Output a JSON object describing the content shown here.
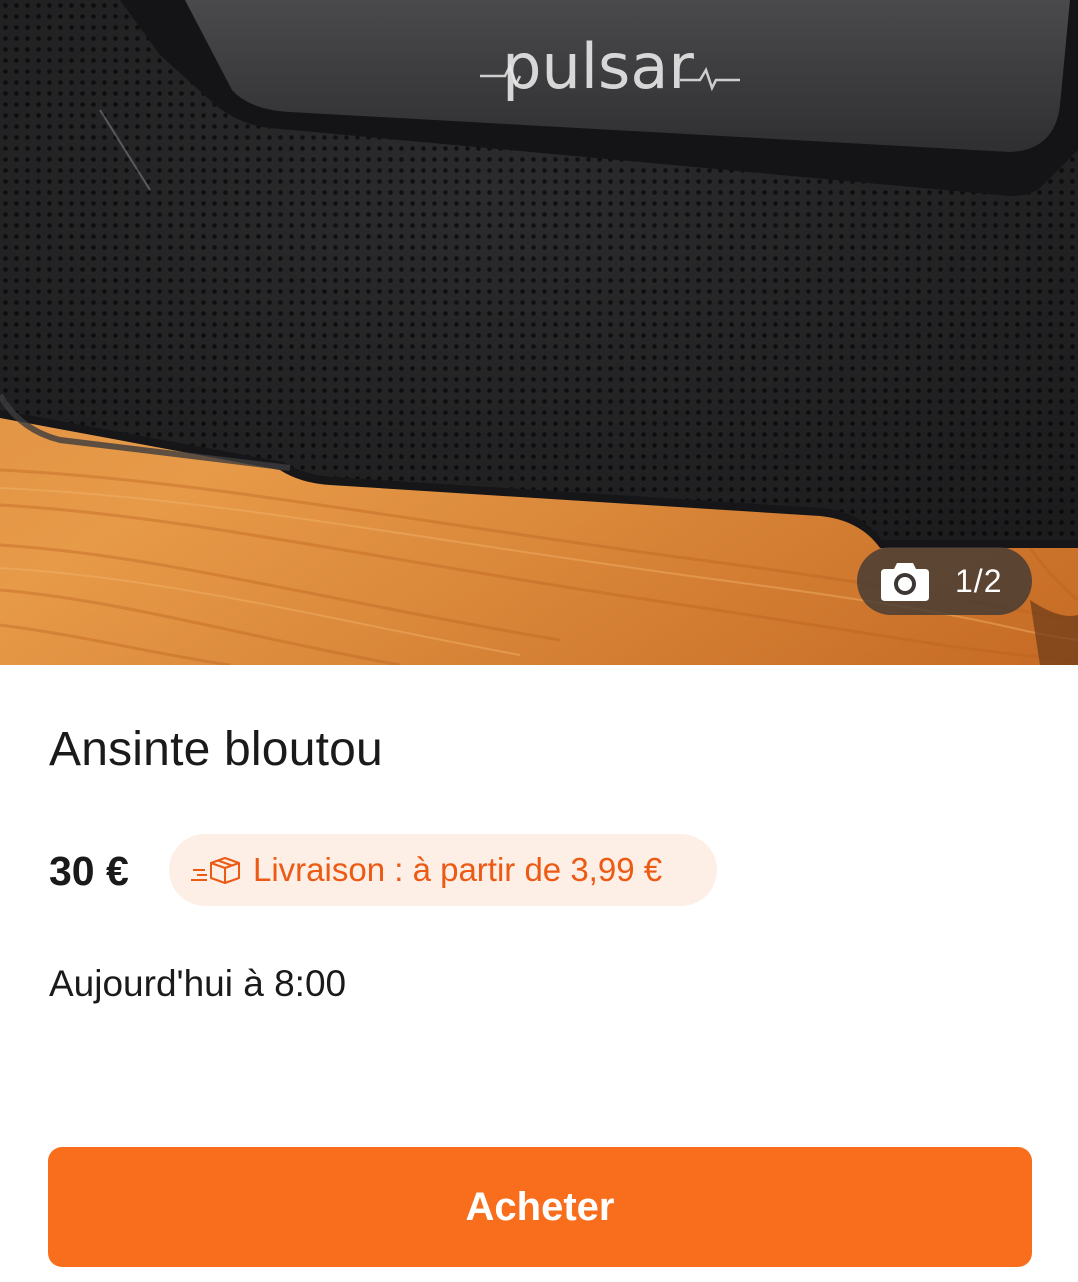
{
  "listing": {
    "photo_alt": "Enceinte Pulsar",
    "photo_brand_text": "pulsar",
    "photo_counter": "1/2",
    "title": "Ansinte bloutou",
    "price": "30 €",
    "delivery": "Livraison : à partir de 3,99 €",
    "date": "Aujourd'hui à 8:00"
  },
  "actions": {
    "buy_label": "Acheter"
  },
  "icons": {
    "photo_counter_icon": "camera-icon",
    "delivery_icon": "delivery-truck-icon"
  },
  "colors": {
    "accent": "#f86e1c",
    "delivery_text": "#ec5a13",
    "delivery_badge_bg": "#fdeee6",
    "text": "#1a1a1a"
  }
}
